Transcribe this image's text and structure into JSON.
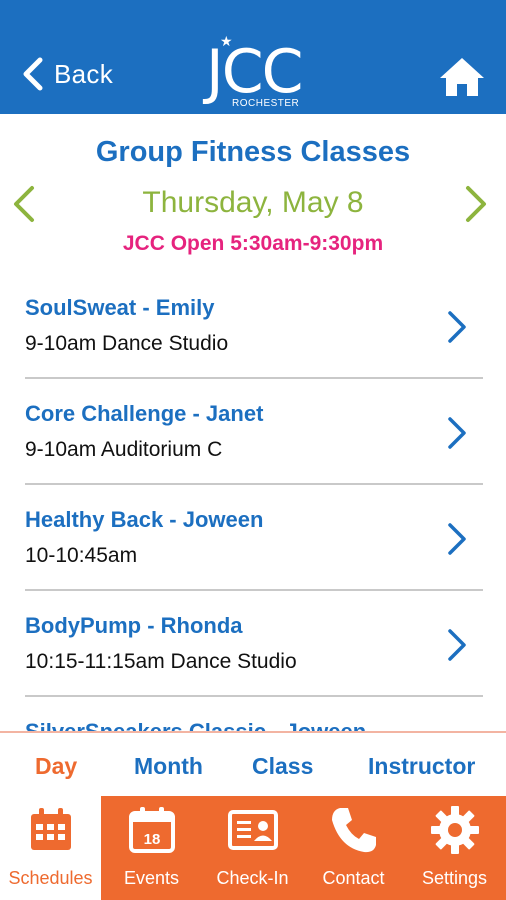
{
  "header": {
    "back_label": "Back",
    "logo_text": "JCC",
    "logo_subtext": "ROCHESTER",
    "home_icon": "home-icon"
  },
  "page": {
    "title": "Group Fitness Classes",
    "date": "Thursday, May 8",
    "hours": "JCC Open 5:30am-9:30pm"
  },
  "classes": [
    {
      "title": "SoulSweat - Emily",
      "detail": "9-10am Dance Studio"
    },
    {
      "title": "Core Challenge - Janet",
      "detail": "9-10am Auditorium C"
    },
    {
      "title": "Healthy Back - Joween",
      "detail": "10-10:45am"
    },
    {
      "title": "BodyPump - Rhonda",
      "detail": "10:15-11:15am Dance Studio"
    },
    {
      "title": "SilverSneakers Classic - Joween",
      "detail": ""
    }
  ],
  "tabs": [
    {
      "label": "Day",
      "active": true
    },
    {
      "label": "Month",
      "active": false
    },
    {
      "label": "Class",
      "active": false
    },
    {
      "label": "Instructor",
      "active": false
    }
  ],
  "nav": [
    {
      "label": "Schedules",
      "icon": "calendar-grid-icon",
      "active": true
    },
    {
      "label": "Events",
      "icon": "calendar-18-icon",
      "active": false,
      "icon_text": "18"
    },
    {
      "label": "Check-In",
      "icon": "id-card-icon",
      "active": false
    },
    {
      "label": "Contact",
      "icon": "phone-icon",
      "active": false
    },
    {
      "label": "Settings",
      "icon": "gear-icon",
      "active": false
    }
  ],
  "colors": {
    "brand_blue": "#1c6fc0",
    "accent_orange": "#ee6a2f",
    "date_green": "#8db43e",
    "hours_pink": "#e6237e"
  }
}
